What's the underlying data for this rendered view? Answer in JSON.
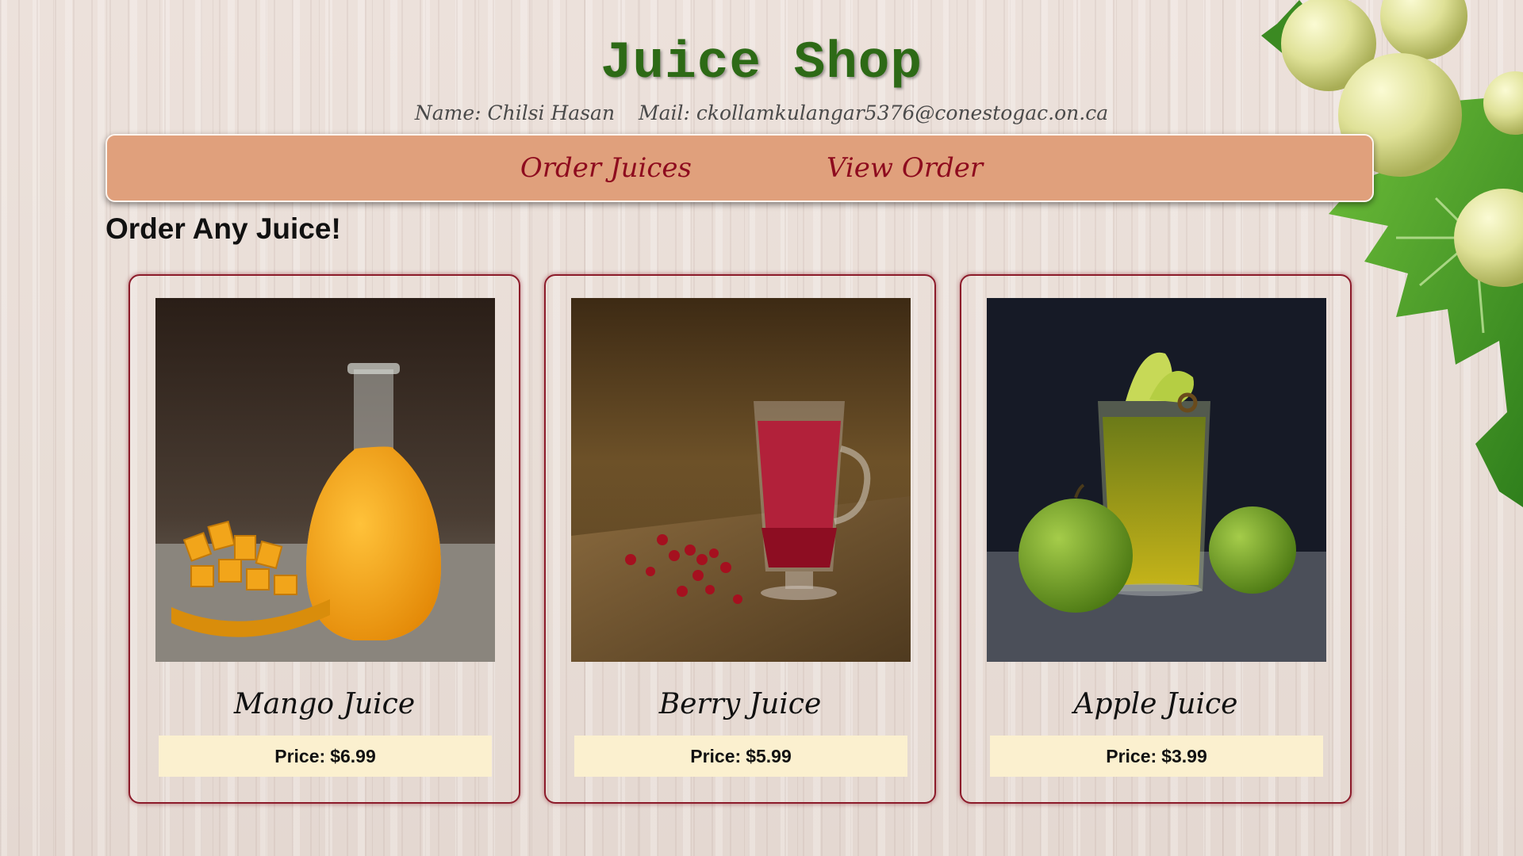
{
  "header": {
    "title": "Juice Shop",
    "name_label": "Name: Chilsi Hasan",
    "mail_label": "Mail: ckollamkulangar5376@conestogac.on.ca"
  },
  "nav": {
    "order_juices": "Order Juices",
    "view_order": "View Order"
  },
  "main": {
    "heading": "Order Any Juice!"
  },
  "products": [
    {
      "name": "Mango Juice",
      "price_label": "Price:",
      "price": "$6.99",
      "photo_icon": "mango-juice-photo"
    },
    {
      "name": "Berry Juice",
      "price_label": "Price:",
      "price": "$5.99",
      "photo_icon": "berry-juice-photo"
    },
    {
      "name": "Apple Juice",
      "price_label": "Price:",
      "price": "$3.99",
      "photo_icon": "apple-juice-photo"
    }
  ],
  "colors": {
    "title_green": "#2d6a16",
    "nav_background": "#e0a07c",
    "nav_link": "#8e0b1e",
    "card_border": "#8c1b2a",
    "price_background": "#fbf0cf"
  }
}
